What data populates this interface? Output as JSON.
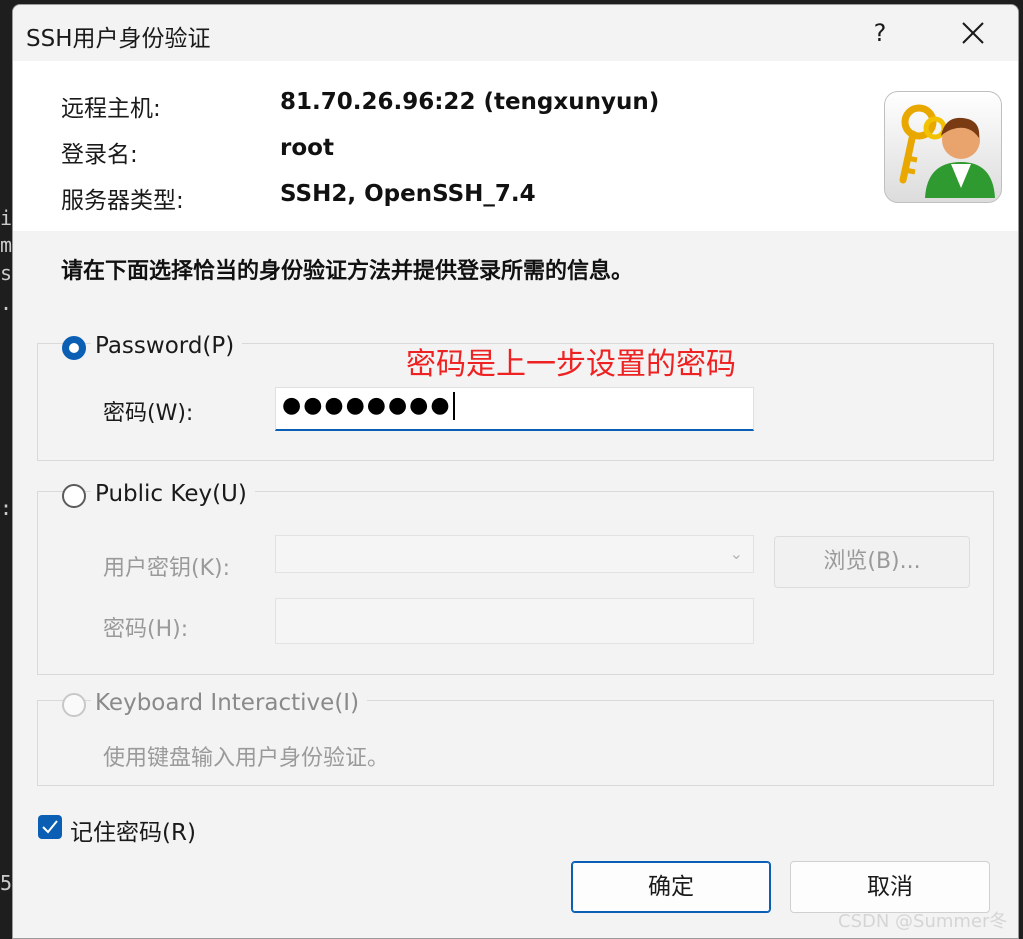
{
  "background_terminal": {
    "chars": [
      "i",
      "m",
      "s",
      ".",
      ":",
      "5"
    ]
  },
  "window": {
    "title": "SSH用户身份验证",
    "help_label": "?"
  },
  "host_info": {
    "rows": [
      {
        "label": "远程主机:",
        "value": "81.70.26.96:22 (tengxunyun)"
      },
      {
        "label": "登录名:",
        "value": "root"
      },
      {
        "label": "服务器类型:",
        "value": "SSH2, OpenSSH_7.4"
      }
    ],
    "icon": "key-user-icon"
  },
  "instruction": "请在下面选择恰当的身份验证方法并提供登录所需的信息。",
  "password_method": {
    "label": "Password(P)",
    "selected": true,
    "field_label": "密码(W):",
    "field_value": "●●●●●●●●",
    "annotation": "密码是上一步设置的密码"
  },
  "public_key_method": {
    "label": "Public Key(U)",
    "selected": false,
    "key_label": "用户密钥(K):",
    "browse_label": "浏览(B)...",
    "passphrase_label": "密码(H):"
  },
  "keyboard_method": {
    "label": "Keyboard Interactive(I)",
    "selected": false,
    "description": "使用键盘输入用户身份验证。"
  },
  "remember": {
    "label": "记住密码(R)",
    "checked": true
  },
  "buttons": {
    "ok": "确定",
    "cancel": "取消"
  },
  "watermark": "CSDN @Summer冬天",
  "colors": {
    "accent": "#0a5fb4",
    "annotation": "#ee2222"
  }
}
